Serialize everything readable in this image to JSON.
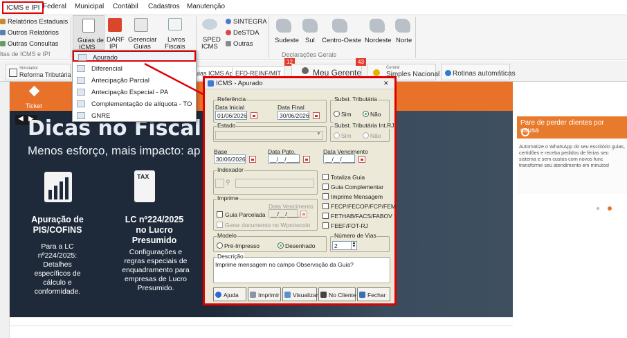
{
  "menu": {
    "tabs": [
      "ICMS e IPI",
      "Federal",
      "Municipal",
      "Contábil",
      "Cadastros",
      "Manutenção"
    ]
  },
  "ribbon": {
    "relatorios": [
      "Relatórios Estaduais",
      "Outros Relatórios",
      "Outras Consultas"
    ],
    "group_left": "ltas de ICMS e IPI",
    "guias": {
      "l1": "Guias de",
      "l2": "ICMS"
    },
    "darf": {
      "l1": "DARF",
      "l2": "IPI"
    },
    "gerenciar": {
      "l1": "Gerenciar",
      "l2": "Guias"
    },
    "livros": {
      "l1": "Livros",
      "l2": "Fiscais"
    },
    "sped": {
      "l1": "SPED",
      "l2": "ICMS"
    },
    "sintegra": "SINTEGRA",
    "destda": "DeSTDA",
    "outras": "Outras",
    "regions": [
      "Sudeste",
      "Sul",
      "Centro-Oeste",
      "Nordeste",
      "Norte"
    ],
    "group_right": "Declarações Gerais"
  },
  "dropdown": [
    "Apurado",
    "Diferencial",
    "Antecipação Parcial",
    "Antecipação Especial - PA",
    "Complementação de alíquota - TO",
    "GNRE"
  ],
  "tabs": {
    "simulador_small": "Simulador",
    "simulador": "Reforma Tributária",
    "guias_apurado": "Guias ICMS Apurado",
    "reinf": "EFD-REINF/MIT",
    "badge1": "12",
    "gerente": "Meu Gerente",
    "badge2": "43",
    "central_small": "Central",
    "simples": "Simples Nacional",
    "rotinas": "Rotinas automáticas"
  },
  "banner": {
    "ticket": "Ticket",
    "title": "Dicas no Fiscal",
    "subtitle": "Menos esforço, mais impacto: ap",
    "tax": "TAX",
    "card1": {
      "title": "Apuração de PIS/COFINS",
      "body": "Para a LC nº224/2025: Detalhes específicos de cálculo e conformidade."
    },
    "card2": {
      "title": "LC nº224/2025 no Lucro Presumido",
      "body": "Configurações e regras especiais de enquadramento para empresas de Lucro Presumido."
    }
  },
  "right_panel": {
    "title": "Pare de perder clientes por causa",
    "body": "Automatize o WhatsApp do seu escritório guias, certidões e receba pedidos de férias seu sistema e sem custos com novos func transforme seu atendimento em minutos!"
  },
  "dialog": {
    "title": "ICMS - Apurado",
    "close": "✕",
    "referencia": "Referência",
    "data_inicial_label": "Data Inicial",
    "data_inicial": "01/06/2026",
    "data_final_label": "Data Final",
    "data_final": "30/06/2026",
    "subst": "Subst. Tributária",
    "sim": "Sim",
    "nao": "Não",
    "estado": "Estado",
    "subst_rj": "Subst. Tributária Int.RJ",
    "base_label": "Base",
    "base": "30/06/2026",
    "data_pgto_label": "Data Pgto.",
    "data_pgto": "__/__/____",
    "data_venc_label": "Data Vencimento",
    "data_venc": "__/__/____",
    "indexador": "Indexador",
    "checks": [
      "Totaliza Guia",
      "Guia Complementar",
      "Imprime Mensagem",
      "FECP/FECOP/FCP/FEM",
      "FETHAB/FACS/FABOV",
      "FEEF/FOT-RJ"
    ],
    "imprime": "Imprime",
    "guia_parcelada": "Guia Parcelada",
    "data_venc2_label": "Data Vencimento",
    "data_venc2": "__/__/____",
    "gerar": "Gerar documento no Wprotocolo",
    "modelo": "Modelo",
    "pre_impresso": "Pré-Impresso",
    "desenhado": "Desenhado",
    "num_vias_label": "Número de Vias",
    "num_vias": "2",
    "descricao": "Descrição",
    "descricao_text": "Imprime mensagem no campo Observação da Guia?",
    "buttons": [
      "Ajuda",
      "Imprimir",
      "Visualizar",
      "No Cliente",
      "Fechar"
    ]
  }
}
